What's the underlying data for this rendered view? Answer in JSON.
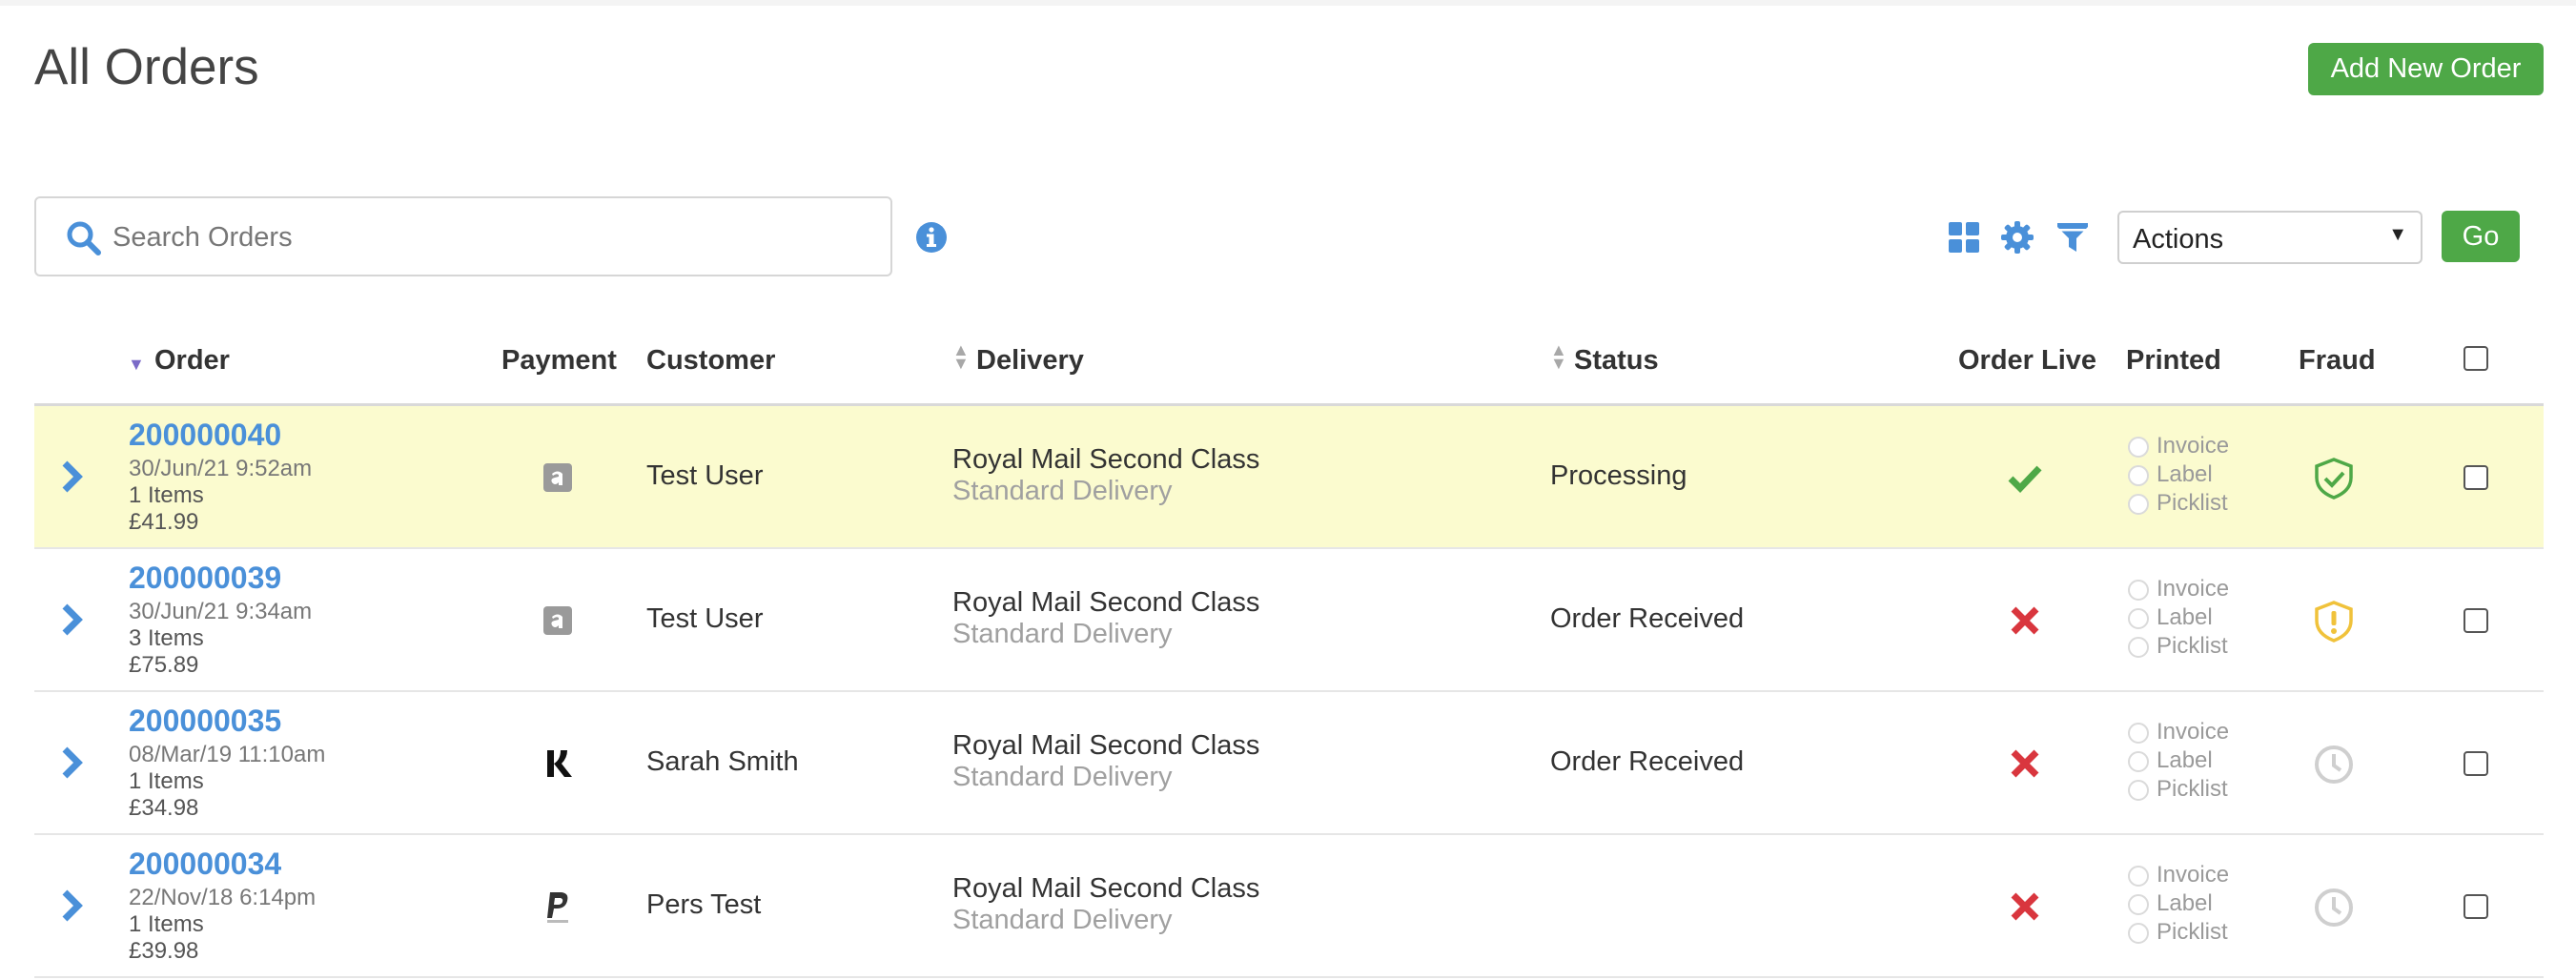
{
  "page": {
    "title": "All Orders",
    "add_button": "Add New Order"
  },
  "toolbar": {
    "search_placeholder": "Search Orders",
    "actions_selected": "Actions",
    "go_label": "Go",
    "icons": [
      "search-icon",
      "info-icon",
      "grid-view-icon",
      "gear-icon",
      "filter-icon"
    ]
  },
  "colors": {
    "accent_green": "#4ea847",
    "link_blue": "#4a90d9",
    "highlight_row": "#fbfbcf",
    "error_red": "#d9363e",
    "warning_yellow": "#f0c23b"
  },
  "table": {
    "headers": {
      "order": "Order",
      "payment": "Payment",
      "customer": "Customer",
      "delivery": "Delivery",
      "status": "Status",
      "order_live": "Order Live",
      "printed": "Printed",
      "fraud": "Fraud"
    },
    "rows": [
      {
        "order_id": "200000040",
        "date": "30/Jun/21 9:52am",
        "items": "1 Items",
        "total": "£41.99",
        "payment_icon": "amazon-pay-icon",
        "customer": "Test User",
        "delivery_method": "Royal Mail Second Class",
        "delivery_type": "Standard Delivery",
        "status": "Processing",
        "order_live": "check-icon",
        "printed": [
          "Invoice",
          "Label",
          "Picklist"
        ],
        "fraud": "shield-check-icon"
      },
      {
        "order_id": "200000039",
        "date": "30/Jun/21 9:34am",
        "items": "3 Items",
        "total": "£75.89",
        "payment_icon": "amazon-pay-icon",
        "customer": "Test User",
        "delivery_method": "Royal Mail Second Class",
        "delivery_type": "Standard Delivery",
        "status": "Order Received",
        "order_live": "cross-icon",
        "printed": [
          "Invoice",
          "Label",
          "Picklist"
        ],
        "fraud": "shield-warning-icon"
      },
      {
        "order_id": "200000035",
        "date": "08/Mar/19 11:10am",
        "items": "1 Items",
        "total": "£34.98",
        "payment_icon": "klarna-icon",
        "customer": "Sarah Smith",
        "delivery_method": "Royal Mail Second Class",
        "delivery_type": "Standard Delivery",
        "status": "Order Received",
        "order_live": "cross-icon",
        "printed": [
          "Invoice",
          "Label",
          "Picklist"
        ],
        "fraud": "clock-icon"
      },
      {
        "order_id": "200000034",
        "date": "22/Nov/18 6:14pm",
        "items": "1 Items",
        "total": "£39.98",
        "payment_icon": "paypal-icon",
        "customer": "Pers Test",
        "delivery_method": "Royal Mail Second Class",
        "delivery_type": "Standard Delivery",
        "status": "",
        "order_live": "cross-icon",
        "printed": [
          "Invoice",
          "Label",
          "Picklist"
        ],
        "fraud": "clock-icon"
      }
    ]
  }
}
